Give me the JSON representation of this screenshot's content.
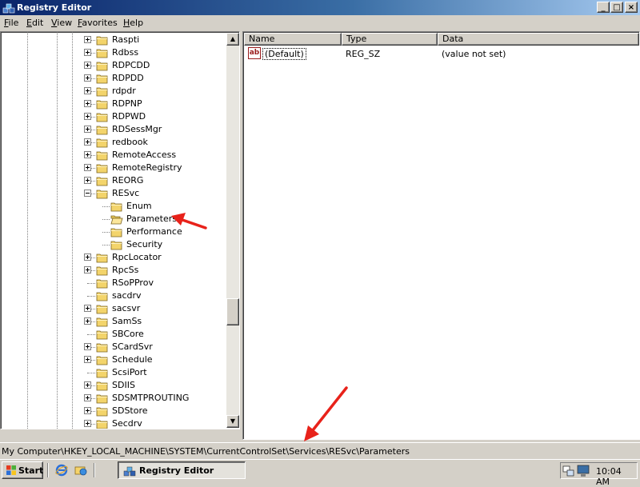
{
  "window": {
    "title": "Registry Editor",
    "controls": {
      "minimize": "_",
      "maximize": "□",
      "close": "×"
    }
  },
  "menu": [
    {
      "label": "File",
      "accel": "F",
      "rest": "ile"
    },
    {
      "label": "Edit",
      "accel": "E",
      "rest": "dit"
    },
    {
      "label": "View",
      "accel": "V",
      "rest": "iew"
    },
    {
      "label": "Favorites",
      "accel": "F",
      "rest": "avorites"
    },
    {
      "label": "Help",
      "accel": "H",
      "rest": "elp"
    }
  ],
  "tree": {
    "items": [
      {
        "label": "Raspti",
        "level": 1,
        "expander": "plus"
      },
      {
        "label": "Rdbss",
        "level": 1,
        "expander": "plus"
      },
      {
        "label": "RDPCDD",
        "level": 1,
        "expander": "plus"
      },
      {
        "label": "RDPDD",
        "level": 1,
        "expander": "plus"
      },
      {
        "label": "rdpdr",
        "level": 1,
        "expander": "plus"
      },
      {
        "label": "RDPNP",
        "level": 1,
        "expander": "plus"
      },
      {
        "label": "RDPWD",
        "level": 1,
        "expander": "plus"
      },
      {
        "label": "RDSessMgr",
        "level": 1,
        "expander": "plus"
      },
      {
        "label": "redbook",
        "level": 1,
        "expander": "plus"
      },
      {
        "label": "RemoteAccess",
        "level": 1,
        "expander": "plus"
      },
      {
        "label": "RemoteRegistry",
        "level": 1,
        "expander": "plus"
      },
      {
        "label": "REORG",
        "level": 1,
        "expander": "plus"
      },
      {
        "label": "RESvc",
        "level": 1,
        "expander": "minus"
      },
      {
        "label": "Enum",
        "level": 2,
        "expander": "none"
      },
      {
        "label": "Parameters",
        "level": 2,
        "expander": "none",
        "open": true
      },
      {
        "label": "Performance",
        "level": 2,
        "expander": "none"
      },
      {
        "label": "Security",
        "level": 2,
        "expander": "none"
      },
      {
        "label": "RpcLocator",
        "level": 1,
        "expander": "plus"
      },
      {
        "label": "RpcSs",
        "level": 1,
        "expander": "plus"
      },
      {
        "label": "RSoPProv",
        "level": 1,
        "expander": "none"
      },
      {
        "label": "sacdrv",
        "level": 1,
        "expander": "none"
      },
      {
        "label": "sacsvr",
        "level": 1,
        "expander": "plus"
      },
      {
        "label": "SamSs",
        "level": 1,
        "expander": "plus"
      },
      {
        "label": "SBCore",
        "level": 1,
        "expander": "none"
      },
      {
        "label": "SCardSvr",
        "level": 1,
        "expander": "plus"
      },
      {
        "label": "Schedule",
        "level": 1,
        "expander": "plus"
      },
      {
        "label": "ScsiPort",
        "level": 1,
        "expander": "none"
      },
      {
        "label": "SDIIS",
        "level": 1,
        "expander": "plus"
      },
      {
        "label": "SDSMTPROUTING",
        "level": 1,
        "expander": "plus"
      },
      {
        "label": "SDStore",
        "level": 1,
        "expander": "plus"
      },
      {
        "label": "Secdrv",
        "level": 1,
        "expander": "plus"
      }
    ]
  },
  "scrollbar": {
    "up": "▲",
    "down": "▼"
  },
  "list": {
    "columns": [
      "Name",
      "Type",
      "Data"
    ],
    "rows": [
      {
        "icon": "ab",
        "name": "(Default)",
        "type": "REG_SZ",
        "data": "(value not set)"
      }
    ]
  },
  "status": {
    "path": "My Computer\\HKEY_LOCAL_MACHINE\\SYSTEM\\CurrentControlSet\\Services\\RESvc\\Parameters"
  },
  "taskbar": {
    "start_label": "Start",
    "task_label": "Registry Editor",
    "clock": "10:04 AM"
  },
  "colors": {
    "annotation_arrow": "#e8221a",
    "title_gradient_start": "#0a246a",
    "title_gradient_end": "#a6caf0"
  }
}
